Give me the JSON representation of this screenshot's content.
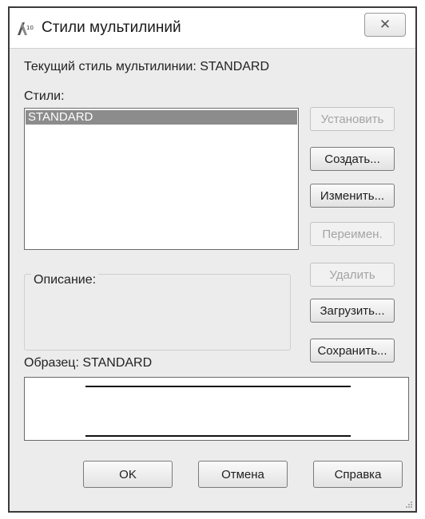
{
  "window": {
    "title": "Стили мультилиний",
    "close_glyph": "✕"
  },
  "current_style": {
    "label": "Текущий стиль мультилинии: STANDARD"
  },
  "styles": {
    "label": "Стили:",
    "items": [
      "STANDARD"
    ],
    "selected": "STANDARD"
  },
  "buttons": {
    "set_current": "Установить",
    "create": "Создать...",
    "modify": "Изменить...",
    "rename": "Переимен.",
    "delete": "Удалить",
    "load": "Загрузить...",
    "save": "Сохранить..."
  },
  "description": {
    "label": "Описание:",
    "value": ""
  },
  "preview": {
    "label": "Образец: STANDARD"
  },
  "footer": {
    "ok": "OK",
    "cancel": "Отмена",
    "help": "Справка"
  },
  "colors": {
    "selection": "#8c8c8c",
    "window_bg": "#ececec",
    "disabled_text": "#a4a4a4"
  }
}
